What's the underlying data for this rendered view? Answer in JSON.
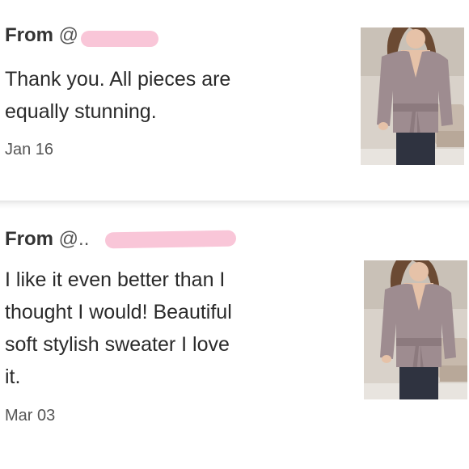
{
  "reviews": [
    {
      "from_label": "From",
      "at_symbol": "@",
      "text_lines": [
        "Thank you. All pieces are",
        "equally stunning."
      ],
      "date": "Jan 16",
      "photo_icon": "product-photo-sweater"
    },
    {
      "from_label": "From",
      "at_symbol": "@..",
      "text_lines": [
        "I like it even better than I",
        "thought I would! Beautiful",
        "soft stylish sweater I love",
        "it."
      ],
      "date": "Mar 03",
      "photo_icon": "product-photo-sweater"
    }
  ],
  "colors": {
    "redaction": "#f9c6d8",
    "sweater": "#9e8c90",
    "text": "#2a2a2a"
  }
}
